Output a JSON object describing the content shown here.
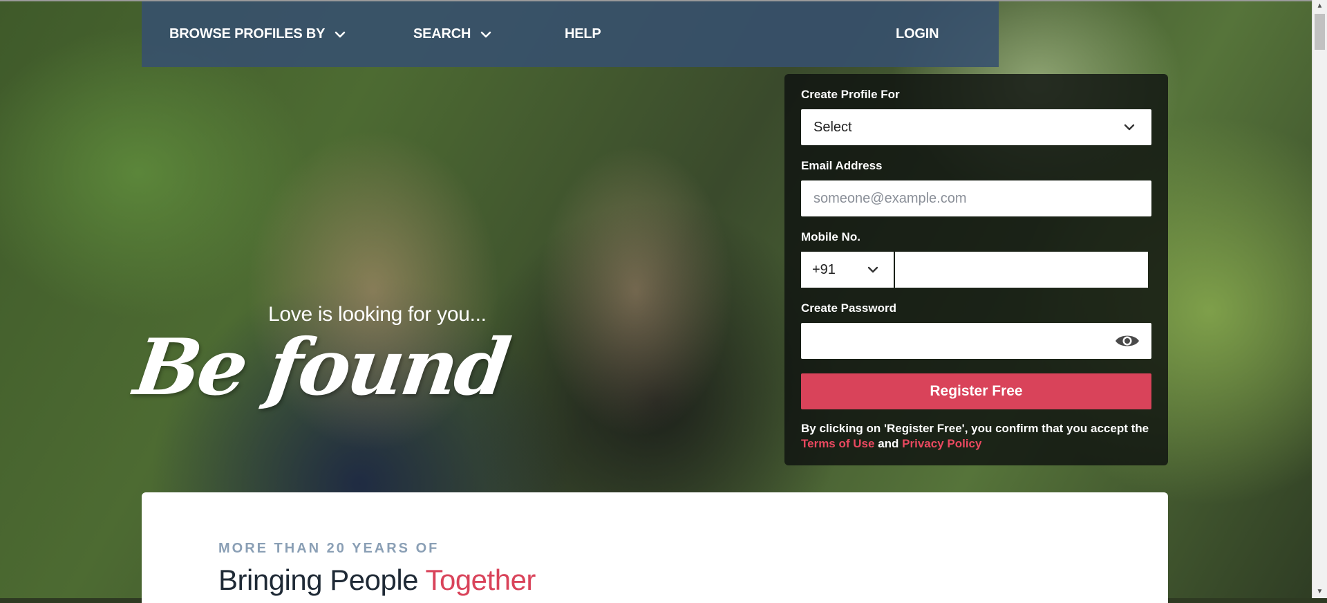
{
  "nav": {
    "browse_label": "BROWSE PROFILES BY",
    "search_label": "SEARCH",
    "help_label": "HELP",
    "login_label": "LOGIN"
  },
  "hero": {
    "tagline": "Love is looking for you...",
    "title": "Be found"
  },
  "form": {
    "profile_for_label": "Create Profile For",
    "profile_for_value": "Select",
    "email_label": "Email Address",
    "email_placeholder": "someone@example.com",
    "mobile_label": "Mobile No.",
    "country_code": "+91",
    "password_label": "Create Password",
    "register_label": "Register Free",
    "disclaimer_prefix": "By clicking on 'Register Free', you confirm that you accept the",
    "terms_link": "Terms of Use",
    "disclaimer_and": "and",
    "privacy_link": "Privacy Policy"
  },
  "content": {
    "overline": "MORE THAN 20 YEARS OF",
    "headline_main": "Bringing People",
    "headline_accent": "Together"
  },
  "colors": {
    "accent": "#d9435a",
    "nav_bg": "#37506e",
    "overline": "#8a9fb5"
  },
  "icons": {
    "chevron": "chevron-down-icon",
    "eye": "eye-icon"
  }
}
